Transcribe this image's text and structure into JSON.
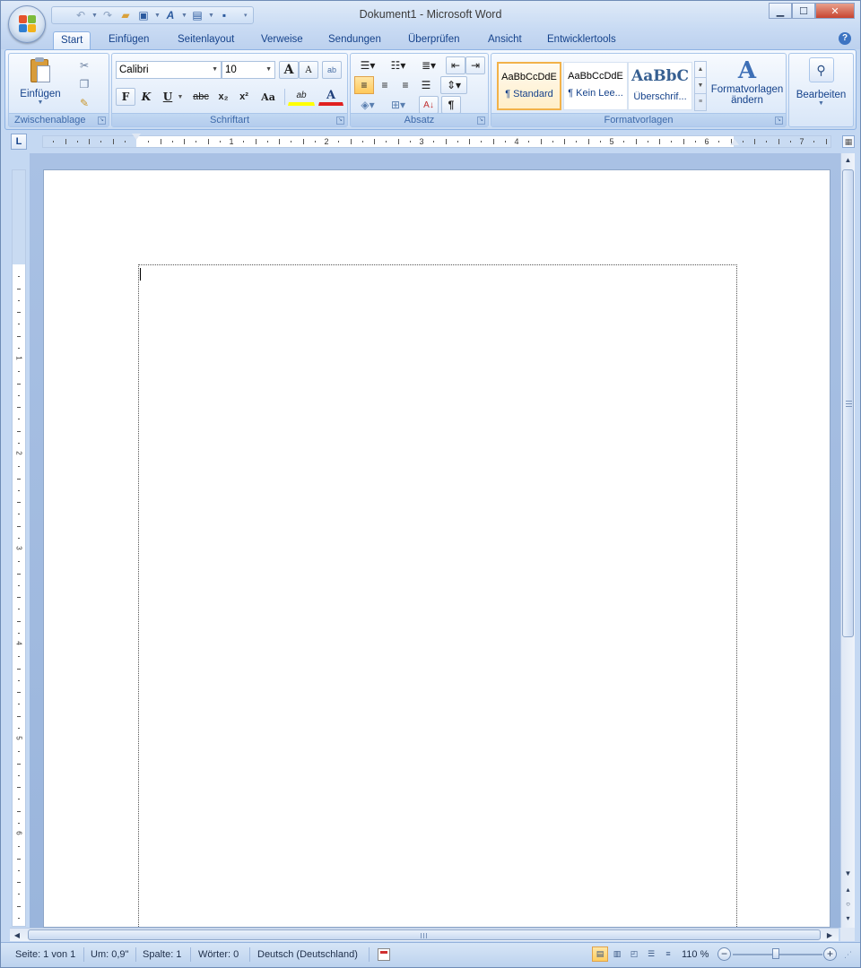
{
  "window": {
    "title": "Dokument1 - Microsoft Word",
    "controls": {
      "minimize": "▁",
      "maximize": "☐",
      "close": "✕"
    }
  },
  "quick_access": {
    "items": [
      {
        "name": "undo-icon",
        "glyph": "↶"
      },
      {
        "name": "redo-icon",
        "glyph": "↷"
      },
      {
        "name": "open-folder-icon",
        "glyph": "📂"
      },
      {
        "name": "print-preview-icon",
        "glyph": "🖶"
      },
      {
        "name": "spelling-icon",
        "glyph": "A"
      },
      {
        "name": "document-icon",
        "glyph": "▤"
      },
      {
        "name": "save-icon",
        "glyph": "💾"
      }
    ]
  },
  "tabs": [
    {
      "label": "Start",
      "active": true
    },
    {
      "label": "Einfügen"
    },
    {
      "label": "Seitenlayout"
    },
    {
      "label": "Verweise"
    },
    {
      "label": "Sendungen"
    },
    {
      "label": "Überprüfen"
    },
    {
      "label": "Ansicht"
    },
    {
      "label": "Entwicklertools"
    }
  ],
  "help": "?",
  "ribbon": {
    "clipboard": {
      "label": "Zwischenablage",
      "paste_label": "Einfügen"
    },
    "font": {
      "label": "Schriftart",
      "font_name": "Calibri",
      "font_size": "10",
      "grow": "A",
      "shrink": "A",
      "clear": "ab",
      "bold": "F",
      "italic": "K",
      "underline": "U",
      "strike": "abc",
      "subscript": "x₂",
      "superscript": "x²",
      "case": "Aa",
      "highlight": "ab",
      "color": "A"
    },
    "paragraph": {
      "label": "Absatz",
      "pilcrow": "¶"
    },
    "styles": {
      "label": "Formatvorlagen",
      "items": [
        {
          "sample": "AaBbCcDdE",
          "name": "¶ Standard"
        },
        {
          "sample": "AaBbCcDdE",
          "name": "¶ Kein Lee..."
        },
        {
          "sample": "AaBbC",
          "name": "Überschrif..."
        }
      ],
      "change_label_1": "Formatvorlagen",
      "change_label_2": "ändern"
    },
    "editing": {
      "label": "Bearbeiten"
    }
  },
  "ruler": {
    "tab_selector": "L",
    "h_numbers": [
      "1",
      "2",
      "3",
      "4",
      "5",
      "6",
      "7"
    ],
    "v_numbers": [
      "1",
      "2",
      "3",
      "4",
      "5",
      "6"
    ]
  },
  "status": {
    "page": "Seite: 1 von 1",
    "position": "Um: 0,9\"",
    "column": "Spalte: 1",
    "words": "Wörter: 0",
    "language": "Deutsch (Deutschland)",
    "zoom": "110 %"
  },
  "colors": {
    "ribbon_blue": "#c4d8f2",
    "text_blue": "#15428b",
    "selected_orange": "#f2b24a"
  }
}
